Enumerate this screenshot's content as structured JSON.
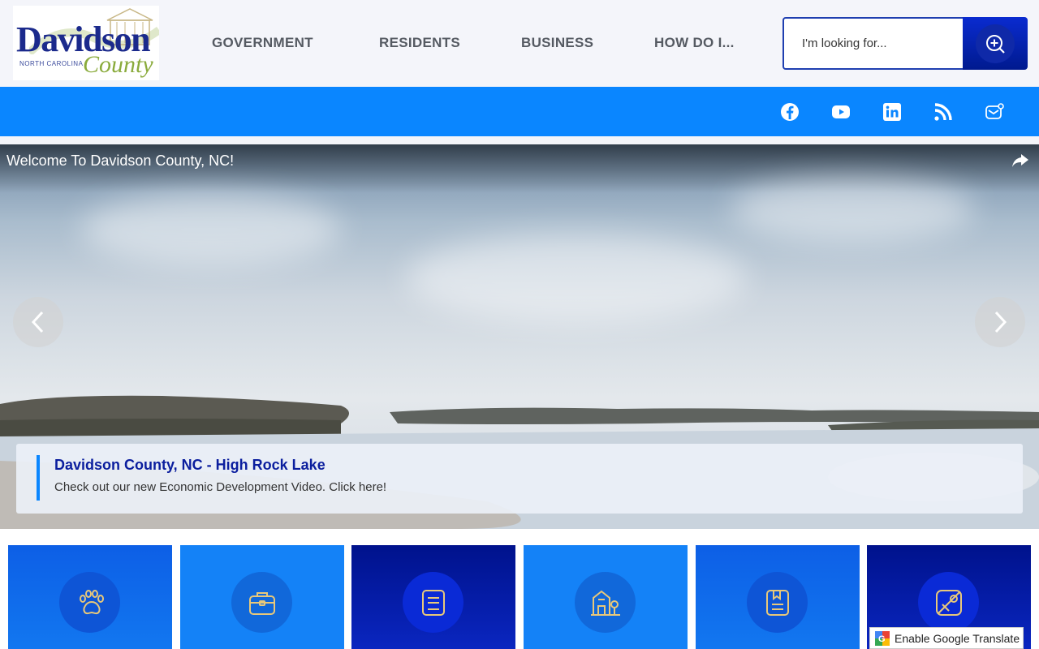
{
  "header": {
    "logo": {
      "title": "Davidson",
      "subtitle": "NORTH CAROLINA",
      "county": "County"
    },
    "nav": [
      {
        "label": "GOVERNMENT"
      },
      {
        "label": "RESIDENTS"
      },
      {
        "label": "BUSINESS"
      },
      {
        "label": "HOW DO I..."
      }
    ],
    "search": {
      "placeholder": "I'm looking for...",
      "icon": "search-icon"
    }
  },
  "social": {
    "icons": [
      "facebook-icon",
      "youtube-icon",
      "linkedin-icon",
      "rss-icon",
      "notify-me-icon"
    ],
    "bar_color": "#0a86ff"
  },
  "hero": {
    "video_title": "Welcome To Davidson County, NC!",
    "caption_title": "Davidson County, NC - High Rock Lake",
    "caption_text": "Check out our new Economic Development Video. Click here!"
  },
  "tiles": {
    "icons": [
      "paw-icon",
      "briefcase-icon",
      "document-icon",
      "building-icon",
      "bookmark-document-icon",
      "map-icon"
    ]
  },
  "translate": {
    "label": "Enable Google Translate"
  },
  "colors": {
    "brand_blue": "#0b1e9e",
    "accent_blue": "#0a86ff",
    "dark_blue": "#001a8f",
    "icon_gold": "#e8c87a"
  }
}
